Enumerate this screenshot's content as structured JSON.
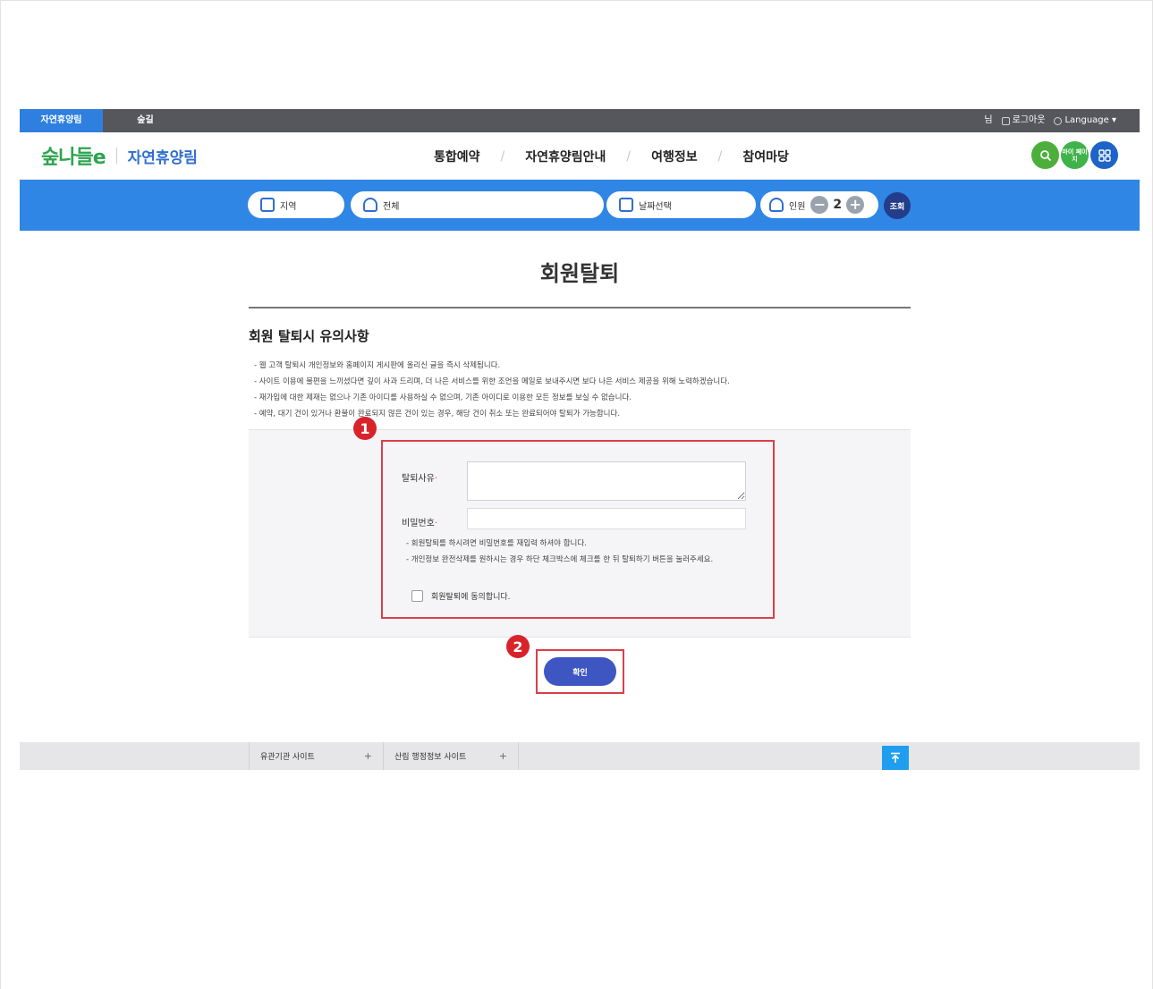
{
  "topbar": {
    "tab_active": "자연휴양림",
    "tab_second": "숲길",
    "user_suffix": "님",
    "logout": "로그아웃",
    "language": "Language ▾"
  },
  "header": {
    "logo_mark": "숲나들e",
    "logo_text": "자연휴양림",
    "nav": [
      "통합예약",
      "자연휴양림안내",
      "여행정보",
      "참여마당"
    ],
    "nav_separator": "/",
    "mypage_label": "마이 페이지"
  },
  "search": {
    "region": "지역",
    "all": "전체",
    "date": "날짜선택",
    "people_label": "인원",
    "people_count": "2",
    "search_btn": "조회"
  },
  "page": {
    "title": "회원탈퇴",
    "notice_title": "회원 탈퇴시 유의사항",
    "notices": [
      "웹 고객 탈퇴시 개인정보와 홈페이지 게시판에 올리신 글을 즉시 삭제됩니다.",
      "사이트 이용에 불편을 느끼셨다면 깊이 사과 드리며, 더 나은 서비스를 위한 조언을 메일로 보내주시면 보다 나은 서비스 제공을 위해 노력하겠습니다.",
      "재가입에 대한 제재는 없으나 기존 아이디를 사용하실 수 없으며, 기존 아이디로 이용한 모든 정보를 보실 수 없습니다.",
      "예약, 대기 건이 있거나 환불이 완료되지 않은 건이 있는 경우, 해당 건이 취소 또는 완료되어야 탈퇴가 가능합니다."
    ]
  },
  "form": {
    "reason_label": "탈퇴사유",
    "password_label": "비밀번호",
    "required_mark": "·",
    "guides": [
      "회원탈퇴를 하시려면 비밀번호를 재입력 하셔야 합니다.",
      "개인정보 완전삭제를 원하시는 경우 하단 체크박스에 체크를 한 뒤 탈퇴하기 버튼을 눌러주세요."
    ],
    "agree_label": "회원탈퇴에 동의합니다.",
    "confirm_btn": "확인"
  },
  "annotations": {
    "badge1": "1",
    "badge2": "2",
    "highlight_color": "#d9404a"
  },
  "footer": {
    "site1": "유관기관 사이트",
    "site2": "산림 행정정보 사이트",
    "plus": "+",
    "top_icon": "arrow-up-to-top"
  },
  "colors": {
    "brand_blue": "#2f86e5",
    "topbar": "#55575c",
    "confirm": "#3e56c2"
  }
}
